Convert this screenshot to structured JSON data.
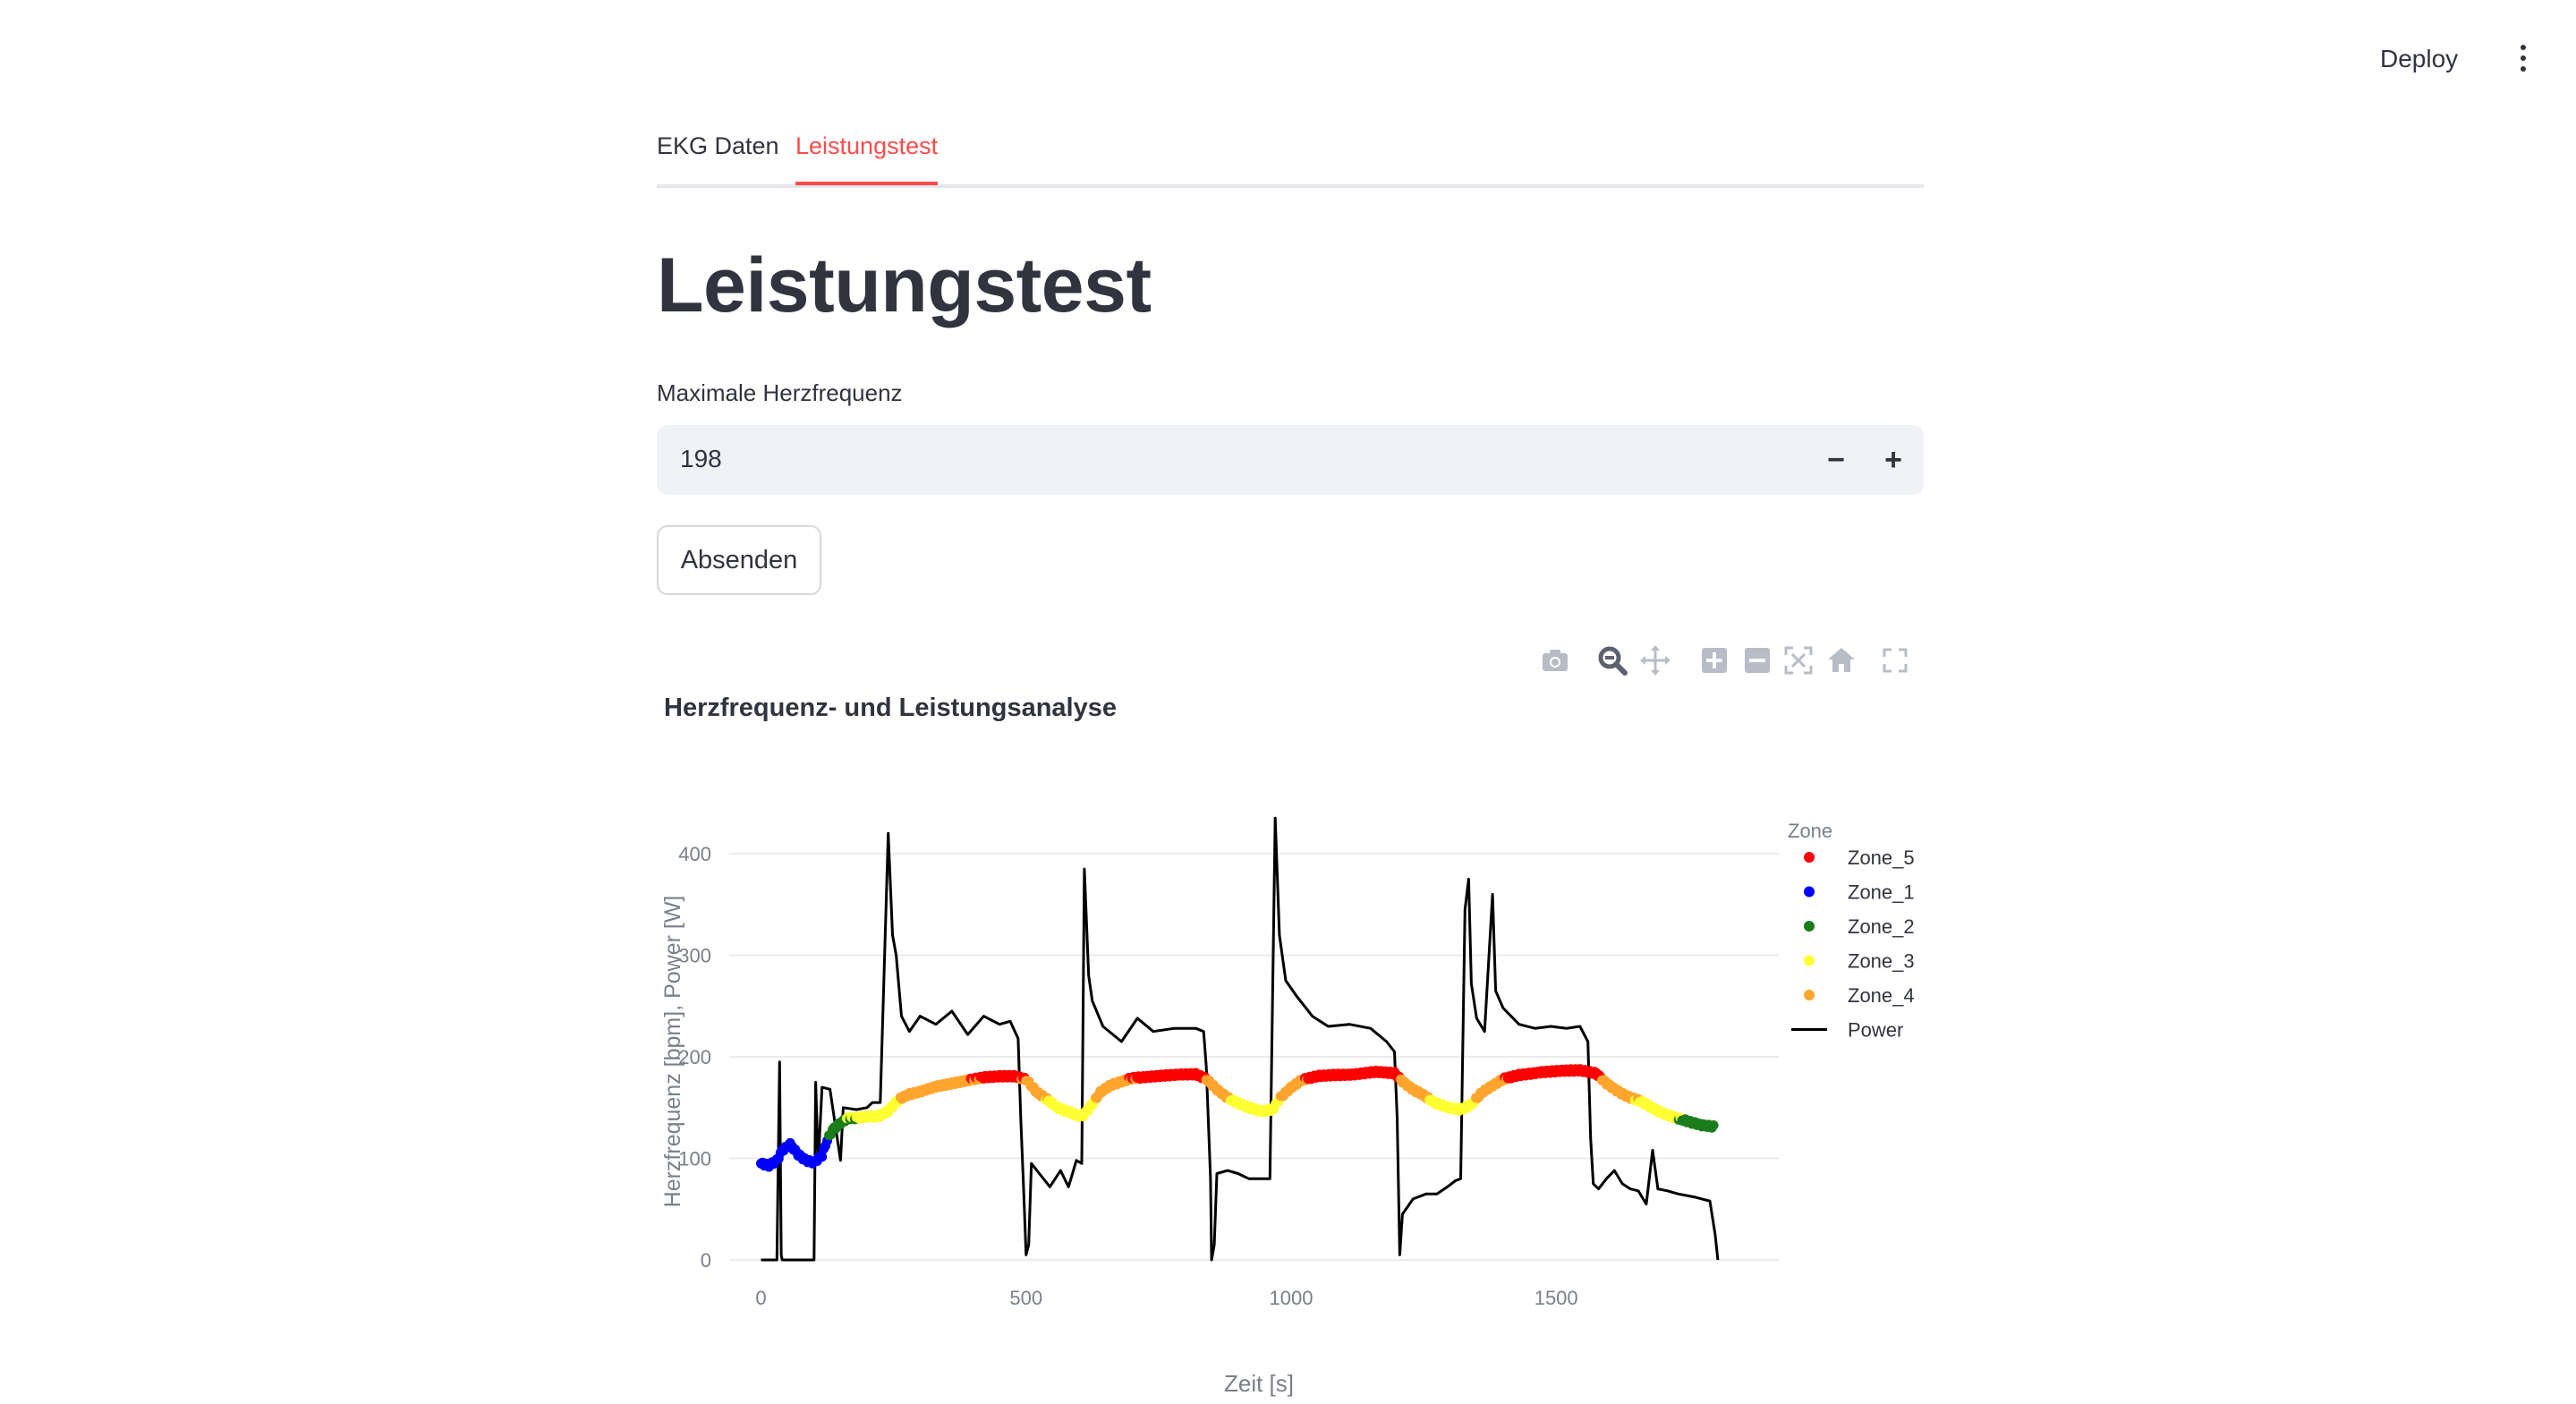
{
  "header": {
    "deploy_label": "Deploy"
  },
  "tabs": [
    {
      "label": "EKG Daten",
      "active": false
    },
    {
      "label": "Leistungstest",
      "active": true
    }
  ],
  "page_title": "Leistungstest",
  "hr_input": {
    "label": "Maximale Herzfrequenz",
    "value": "198",
    "minus": "−",
    "plus": "+"
  },
  "submit_label": "Absenden",
  "modebar": [
    "camera-icon",
    "zoom-icon",
    "pan-icon",
    "zoom-in-icon",
    "zoom-out-icon",
    "autoscale-icon",
    "reset-axes-icon",
    "fullscreen-icon"
  ],
  "chart_data": {
    "type": "line",
    "title": "Herzfrequenz- und Leistungsanalyse",
    "xlabel": "Zeit [s]",
    "ylabel": "Herzfrequenz [bpm], Power [W]",
    "xlim": [
      -60,
      1920
    ],
    "ylim": [
      0,
      430
    ],
    "xticks": [
      0,
      500,
      1000,
      1500
    ],
    "yticks": [
      0,
      100,
      200,
      300,
      400
    ],
    "grid": true,
    "legend": {
      "title": "Zone",
      "position": "right"
    },
    "zone_colors": {
      "Zone_5": "#ff0000",
      "Zone_1": "#0000ff",
      "Zone_2": "#1a7d1a",
      "Zone_3": "#ffff33",
      "Zone_4": "#ffa52e"
    },
    "series": [
      {
        "name": "Zone_5",
        "kind": "markers",
        "color": "#ff0000"
      },
      {
        "name": "Zone_1",
        "kind": "markers",
        "color": "#0000ff"
      },
      {
        "name": "Zone_2",
        "kind": "markers",
        "color": "#1a7d1a"
      },
      {
        "name": "Zone_3",
        "kind": "markers",
        "color": "#ffff33"
      },
      {
        "name": "Zone_4",
        "kind": "markers",
        "color": "#ffa52e"
      },
      {
        "name": "Power",
        "kind": "line",
        "color": "#000000"
      }
    ],
    "heart_rate": [
      [
        0,
        95
      ],
      [
        15,
        93
      ],
      [
        30,
        98
      ],
      [
        40,
        108
      ],
      [
        55,
        114
      ],
      [
        70,
        104
      ],
      [
        85,
        98
      ],
      [
        100,
        96
      ],
      [
        115,
        103
      ],
      [
        125,
        118
      ],
      [
        135,
        128
      ],
      [
        150,
        135
      ],
      [
        165,
        140
      ],
      [
        180,
        140
      ],
      [
        200,
        141
      ],
      [
        220,
        141
      ],
      [
        240,
        147
      ],
      [
        260,
        158
      ],
      [
        280,
        163
      ],
      [
        300,
        166
      ],
      [
        330,
        171
      ],
      [
        360,
        174
      ],
      [
        390,
        177
      ],
      [
        420,
        180
      ],
      [
        450,
        181
      ],
      [
        480,
        181
      ],
      [
        500,
        178
      ],
      [
        520,
        165
      ],
      [
        540,
        158
      ],
      [
        560,
        150
      ],
      [
        585,
        145
      ],
      [
        605,
        141
      ],
      [
        620,
        150
      ],
      [
        640,
        165
      ],
      [
        660,
        172
      ],
      [
        680,
        176
      ],
      [
        700,
        179
      ],
      [
        740,
        181
      ],
      [
        780,
        182
      ],
      [
        820,
        183
      ],
      [
        840,
        178
      ],
      [
        860,
        168
      ],
      [
        880,
        160
      ],
      [
        900,
        154
      ],
      [
        920,
        150
      ],
      [
        945,
        146
      ],
      [
        965,
        148
      ],
      [
        980,
        160
      ],
      [
        1000,
        170
      ],
      [
        1020,
        177
      ],
      [
        1050,
        181
      ],
      [
        1080,
        182
      ],
      [
        1120,
        183
      ],
      [
        1160,
        185
      ],
      [
        1195,
        184
      ],
      [
        1210,
        176
      ],
      [
        1230,
        168
      ],
      [
        1250,
        162
      ],
      [
        1270,
        155
      ],
      [
        1295,
        150
      ],
      [
        1320,
        148
      ],
      [
        1340,
        153
      ],
      [
        1360,
        165
      ],
      [
        1380,
        172
      ],
      [
        1400,
        178
      ],
      [
        1430,
        182
      ],
      [
        1470,
        185
      ],
      [
        1510,
        186
      ],
      [
        1545,
        187
      ],
      [
        1575,
        184
      ],
      [
        1595,
        174
      ],
      [
        1620,
        165
      ],
      [
        1640,
        160
      ],
      [
        1660,
        156
      ],
      [
        1680,
        150
      ],
      [
        1700,
        145
      ],
      [
        1725,
        140
      ],
      [
        1750,
        136
      ],
      [
        1775,
        133
      ],
      [
        1800,
        131
      ]
    ],
    "power": [
      [
        0,
        0
      ],
      [
        30,
        0
      ],
      [
        35,
        195
      ],
      [
        38,
        5
      ],
      [
        40,
        0
      ],
      [
        100,
        0
      ],
      [
        103,
        175
      ],
      [
        108,
        95
      ],
      [
        115,
        170
      ],
      [
        130,
        168
      ],
      [
        150,
        98
      ],
      [
        155,
        150
      ],
      [
        180,
        148
      ],
      [
        200,
        150
      ],
      [
        210,
        155
      ],
      [
        225,
        155
      ],
      [
        240,
        420
      ],
      [
        248,
        320
      ],
      [
        255,
        300
      ],
      [
        265,
        240
      ],
      [
        280,
        225
      ],
      [
        300,
        240
      ],
      [
        330,
        232
      ],
      [
        360,
        245
      ],
      [
        390,
        222
      ],
      [
        420,
        240
      ],
      [
        450,
        232
      ],
      [
        470,
        235
      ],
      [
        485,
        218
      ],
      [
        490,
        140
      ],
      [
        495,
        75
      ],
      [
        500,
        5
      ],
      [
        505,
        15
      ],
      [
        510,
        95
      ],
      [
        525,
        85
      ],
      [
        545,
        72
      ],
      [
        565,
        88
      ],
      [
        580,
        72
      ],
      [
        595,
        98
      ],
      [
        605,
        95
      ],
      [
        610,
        385
      ],
      [
        618,
        280
      ],
      [
        625,
        255
      ],
      [
        645,
        230
      ],
      [
        680,
        215
      ],
      [
        710,
        238
      ],
      [
        740,
        225
      ],
      [
        780,
        228
      ],
      [
        820,
        228
      ],
      [
        835,
        225
      ],
      [
        840,
        190
      ],
      [
        848,
        80
      ],
      [
        850,
        0
      ],
      [
        855,
        15
      ],
      [
        860,
        85
      ],
      [
        880,
        88
      ],
      [
        900,
        85
      ],
      [
        920,
        80
      ],
      [
        940,
        80
      ],
      [
        960,
        80
      ],
      [
        970,
        435
      ],
      [
        978,
        320
      ],
      [
        990,
        275
      ],
      [
        1010,
        260
      ],
      [
        1040,
        240
      ],
      [
        1070,
        230
      ],
      [
        1110,
        232
      ],
      [
        1150,
        228
      ],
      [
        1180,
        215
      ],
      [
        1195,
        205
      ],
      [
        1200,
        140
      ],
      [
        1205,
        5
      ],
      [
        1210,
        45
      ],
      [
        1230,
        60
      ],
      [
        1255,
        65
      ],
      [
        1275,
        65
      ],
      [
        1295,
        72
      ],
      [
        1310,
        78
      ],
      [
        1320,
        80
      ],
      [
        1328,
        345
      ],
      [
        1335,
        375
      ],
      [
        1340,
        272
      ],
      [
        1350,
        238
      ],
      [
        1365,
        225
      ],
      [
        1380,
        360
      ],
      [
        1386,
        265
      ],
      [
        1400,
        248
      ],
      [
        1430,
        232
      ],
      [
        1460,
        228
      ],
      [
        1490,
        230
      ],
      [
        1520,
        228
      ],
      [
        1545,
        230
      ],
      [
        1560,
        215
      ],
      [
        1565,
        120
      ],
      [
        1570,
        75
      ],
      [
        1580,
        70
      ],
      [
        1595,
        80
      ],
      [
        1610,
        88
      ],
      [
        1625,
        75
      ],
      [
        1640,
        70
      ],
      [
        1655,
        68
      ],
      [
        1670,
        55
      ],
      [
        1682,
        108
      ],
      [
        1692,
        70
      ],
      [
        1710,
        68
      ],
      [
        1730,
        65
      ],
      [
        1760,
        62
      ],
      [
        1790,
        58
      ],
      [
        1800,
        25
      ],
      [
        1805,
        0
      ]
    ],
    "zone_thresholds_bpm": [
      118.8,
      138.6,
      158.4,
      178.2
    ]
  }
}
